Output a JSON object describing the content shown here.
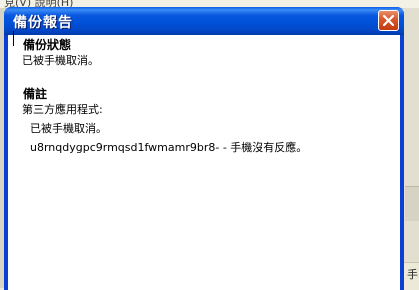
{
  "background": {
    "menu_text": "見(V)    說明(H)",
    "status_fragment": "手"
  },
  "dialog": {
    "title": "備份報告",
    "close_icon": "close-icon",
    "sections": {
      "status_heading": "備份狀態",
      "status_text": "已被手機取消。",
      "notes_heading": "備註",
      "notes_app_label": "第三方應用程式:",
      "notes_app_status": "已被手機取消。",
      "notes_app_detail": "u8rnqdygpc9rmqsd1fwmamr9br8- - 手機沒有反應。"
    }
  },
  "colors": {
    "titlebar": "#0150d8",
    "close_button": "#d9552a",
    "client": "#ffffff"
  }
}
